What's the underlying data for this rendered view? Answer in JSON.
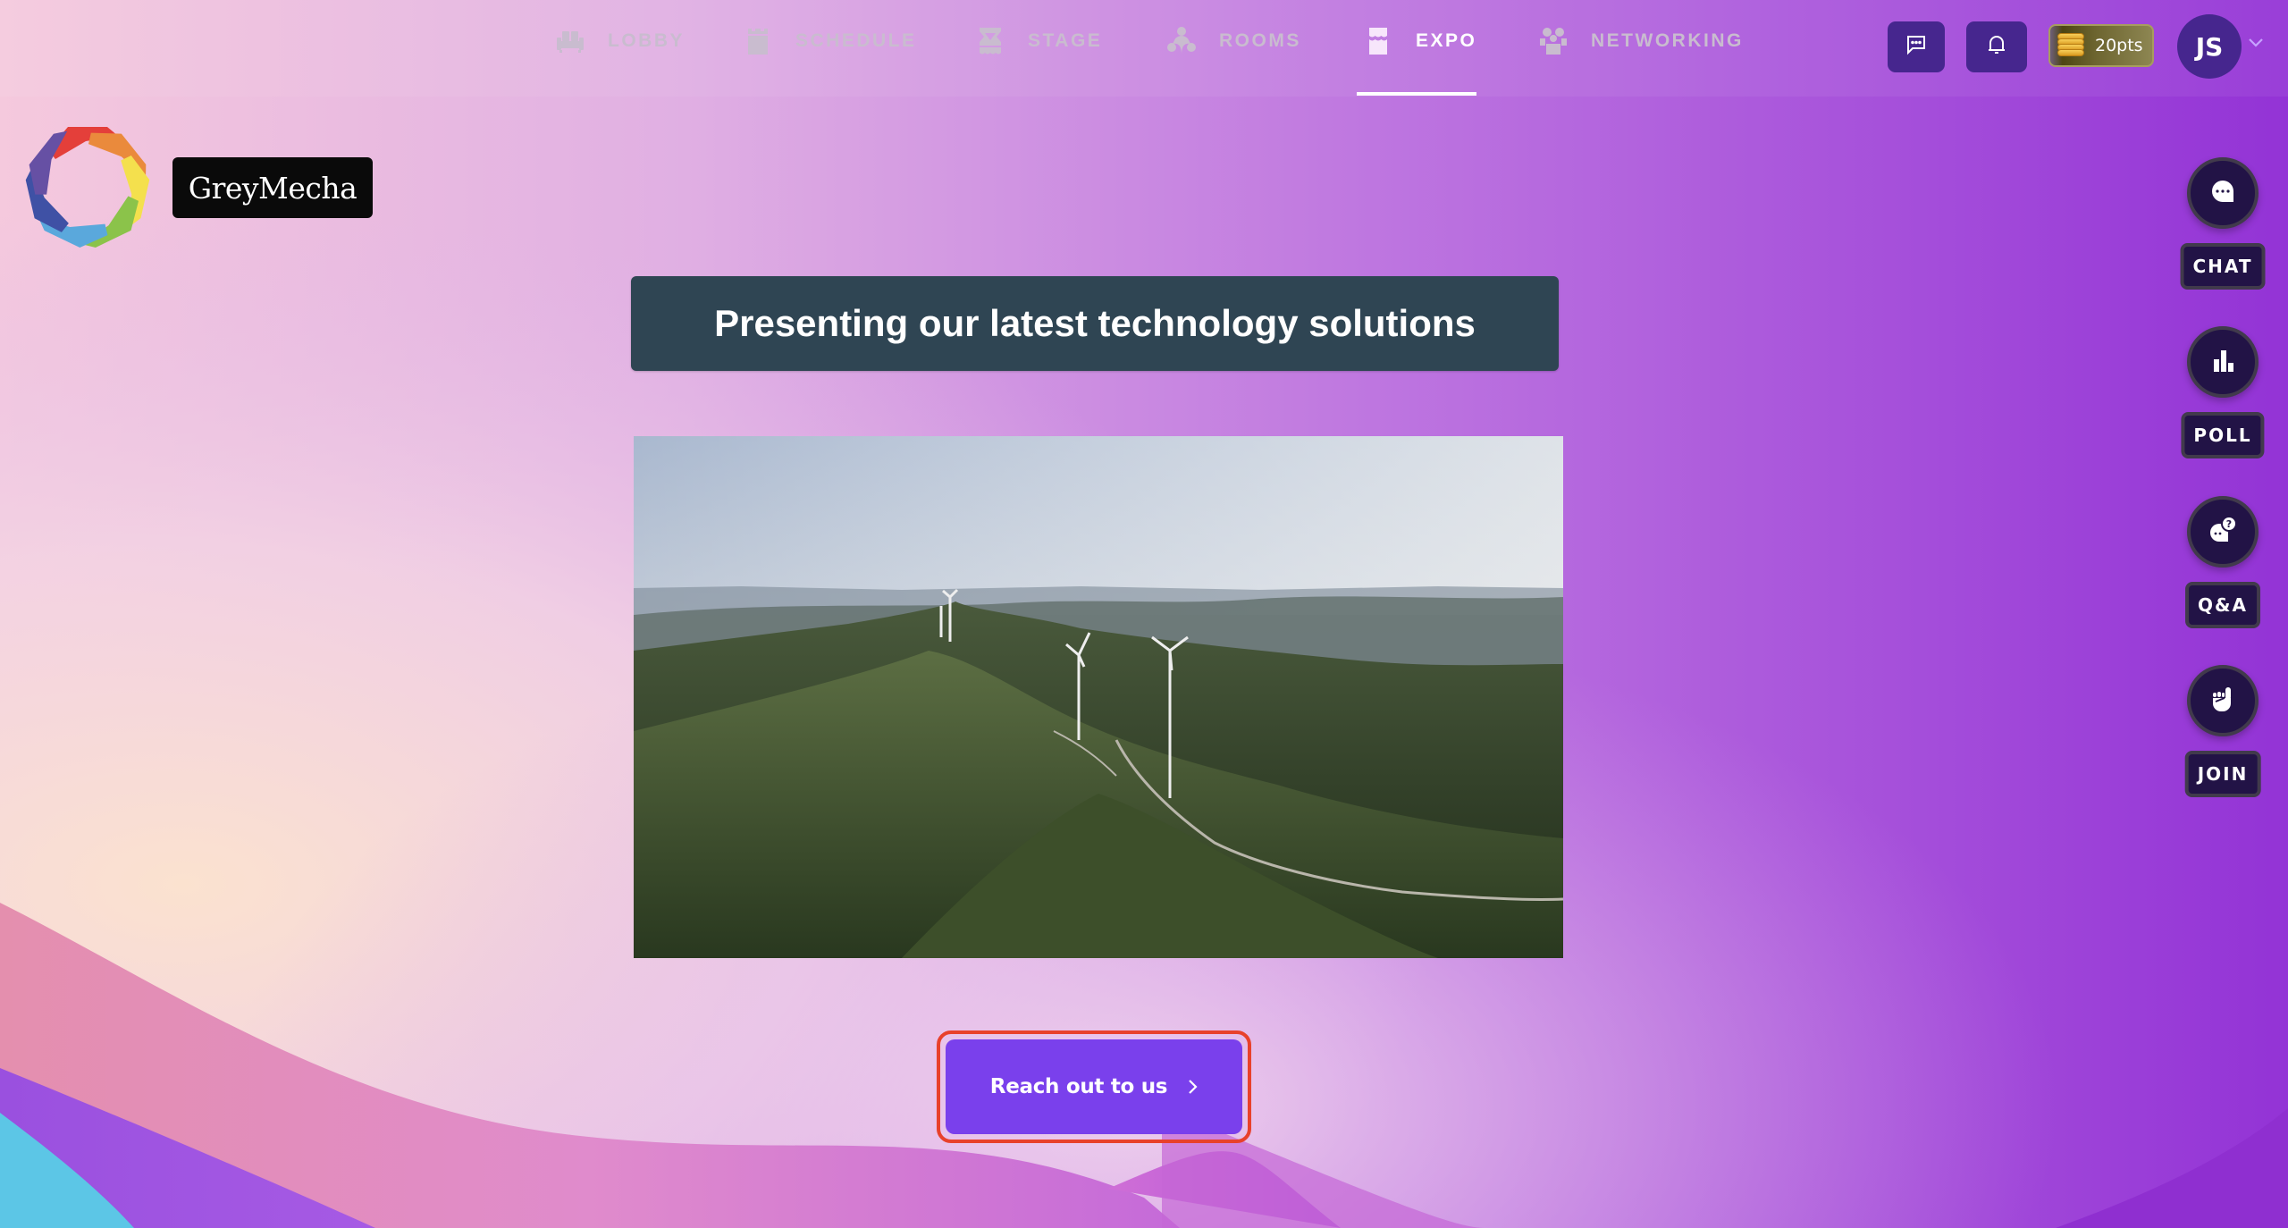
{
  "nav": {
    "items": [
      {
        "label": "LOBBY",
        "icon": "sofa-icon",
        "active": false
      },
      {
        "label": "SCHEDULE",
        "icon": "calendar-icon",
        "active": false
      },
      {
        "label": "STAGE",
        "icon": "stage-curtain-icon",
        "active": false
      },
      {
        "label": "ROOMS",
        "icon": "rooms-icon",
        "active": false
      },
      {
        "label": "EXPO",
        "icon": "booth-icon",
        "active": true
      },
      {
        "label": "NETWORKING",
        "icon": "people-icon",
        "active": false
      }
    ]
  },
  "toolbar": {
    "messages_icon": "message-icon",
    "notifications_icon": "bell-icon",
    "points_label": "20pts",
    "avatar_initials": "JS"
  },
  "brand": {
    "name": "GreyMecha",
    "logo_colors": [
      "#e43f3a",
      "#ea8a3c",
      "#f4e04d",
      "#8bc34a",
      "#5aa8dc",
      "#3f51a5",
      "#6650a4"
    ]
  },
  "main": {
    "title": "Presenting our latest technology solutions",
    "media_description": "Aerial view of wind turbines on green mountain ridges",
    "cta_label": "Reach out to us"
  },
  "side_actions": [
    {
      "label": "CHAT",
      "icon": "chat-bubble-icon"
    },
    {
      "label": "POLL",
      "icon": "bar-chart-icon"
    },
    {
      "label": "Q&A",
      "icon": "question-bubble-icon"
    },
    {
      "label": "JOIN",
      "icon": "raised-hand-icon"
    }
  ],
  "colors": {
    "accent": "#7a40ec",
    "highlight_outline": "#e8412b",
    "nav_active": "#ffffff",
    "nav_inactive": "#c9bccf",
    "dark_button": "#46268e",
    "side_button": "#221346",
    "banner": "#2f4553"
  }
}
